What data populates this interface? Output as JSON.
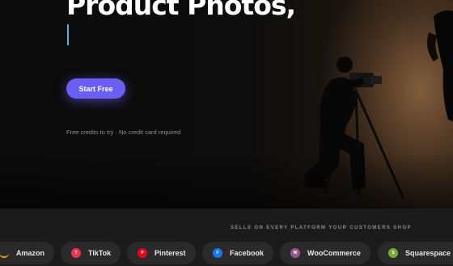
{
  "hero": {
    "headline": "Product Photos,",
    "cta_label": "Start Free",
    "note": "Free credits to try · No credit card required"
  },
  "platforms": {
    "caption": "SELLS ON EVERY PLATFORM YOUR CUSTOMERS SHOP",
    "items": [
      {
        "label": "Amazon",
        "icon": "amazon-icon",
        "mark": "",
        "color": "#ff9900"
      },
      {
        "label": "TikTok",
        "icon": "tiktok-icon",
        "mark": "T",
        "color": "#e8344e"
      },
      {
        "label": "Pinterest",
        "icon": "pinterest-icon",
        "mark": "P",
        "color": "#e60023"
      },
      {
        "label": "Facebook",
        "icon": "facebook-icon",
        "mark": "F",
        "color": "#1877f2"
      },
      {
        "label": "WooCommerce",
        "icon": "woocommerce-icon",
        "mark": "W",
        "color": "#96588a"
      },
      {
        "label": "Squarespace",
        "icon": "squarespace-icon",
        "mark": "S",
        "color": "#7aa63a"
      }
    ]
  },
  "colors": {
    "accent": "#6a5ef5",
    "caret": "#4fb3e8",
    "strip": "#1b1b1b"
  }
}
